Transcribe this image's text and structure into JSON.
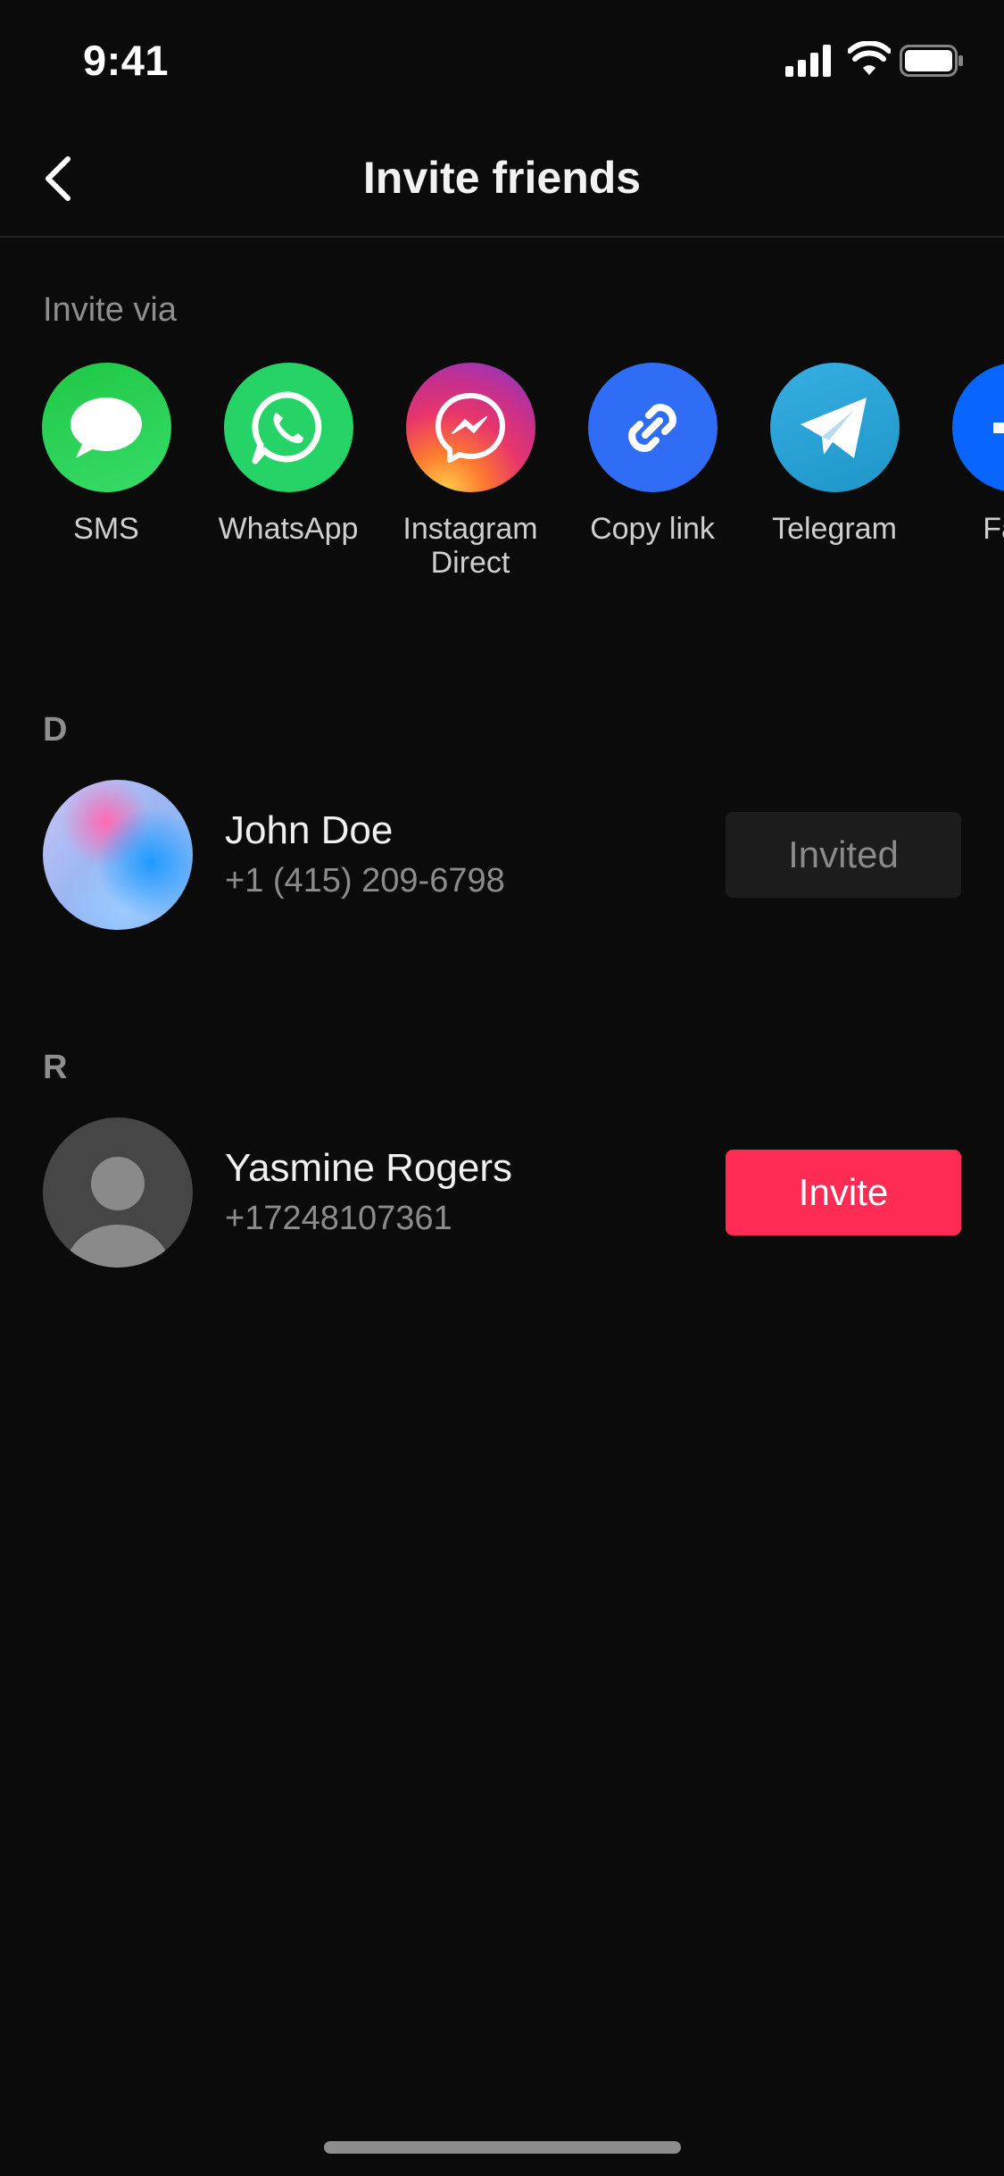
{
  "status": {
    "time": "9:41"
  },
  "header": {
    "title": "Invite friends"
  },
  "invite_via": {
    "label": "Invite via",
    "options": [
      {
        "label": "SMS",
        "icon": "chat-bubble-icon",
        "color": "#27c94f"
      },
      {
        "label": "WhatsApp",
        "icon": "whatsapp-icon",
        "color": "#26d366"
      },
      {
        "label": "Instagram Direct",
        "icon": "messenger-icon",
        "color": "#d6308a"
      },
      {
        "label": "Copy link",
        "icon": "link-icon",
        "color": "#2f6df6"
      },
      {
        "label": "Telegram",
        "icon": "telegram-icon",
        "color": "#2aa5e0"
      },
      {
        "label": "Face",
        "icon": "facebook-icon",
        "color": "#0866ff"
      }
    ]
  },
  "sections": [
    {
      "letter": "D",
      "contacts": [
        {
          "name": "John Doe",
          "phone": "+1 (415) 209-6798",
          "action": "Invited",
          "avatar": "gradient-photo"
        }
      ]
    },
    {
      "letter": "R",
      "contacts": [
        {
          "name": "Yasmine Rogers",
          "phone": "+17248107361",
          "action": "Invite",
          "avatar": "default-person"
        }
      ]
    }
  ],
  "colors": {
    "accent": "#fe2c55",
    "background": "#0b0b0b"
  }
}
